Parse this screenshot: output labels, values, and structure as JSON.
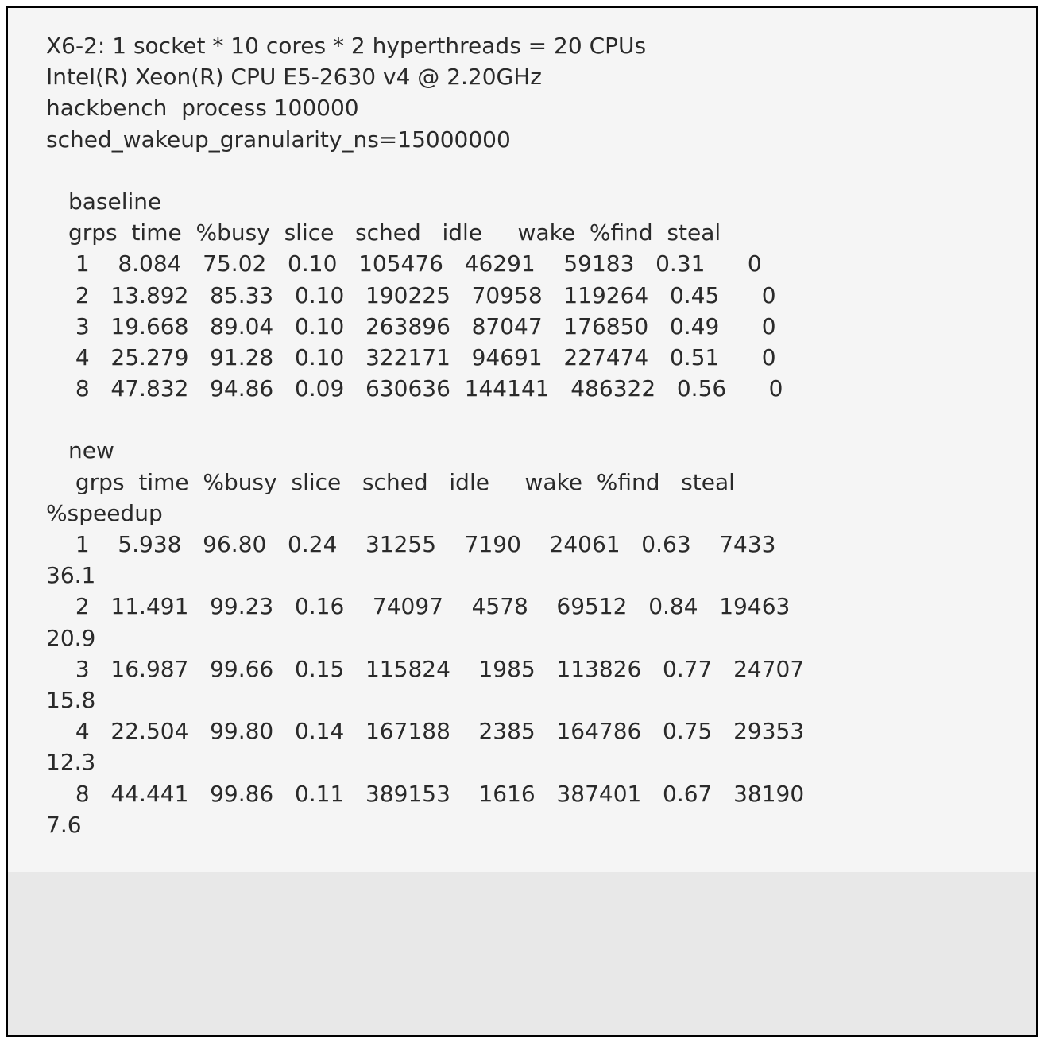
{
  "header": {
    "line1": "X6-2: 1 socket * 10 cores * 2 hyperthreads = 20 CPUs",
    "line2": "Intel(R) Xeon(R) CPU E5-2630 v4 @ 2.20GHz",
    "line3": "hackbench  process 100000",
    "line4": "sched_wakeup_granularity_ns=15000000"
  },
  "baseline": {
    "title": "baseline",
    "columns": "grps  time  %busy  slice   sched   idle     wake  %find  steal",
    "rows": [
      " 1    8.084   75.02   0.10   105476   46291    59183   0.31      0",
      " 2   13.892   85.33   0.10   190225   70958   119264   0.45      0",
      " 3   19.668   89.04   0.10   263896   87047   176850   0.49      0",
      " 4   25.279   91.28   0.10   322171   94691   227474   0.51      0",
      " 8   47.832   94.86   0.09   630636  144141   486322   0.56      0"
    ]
  },
  "new": {
    "title": "new",
    "columns_line1": " grps  time  %busy  slice   sched   idle     wake  %find   steal",
    "columns_line2": "%speedup",
    "rows": [
      " 1    5.938   96.80   0.24    31255    7190    24061   0.63    7433",
      "36.1",
      " 2   11.491   99.23   0.16    74097    4578    69512   0.84   19463",
      "20.9",
      " 3   16.987   99.66   0.15   115824    1985   113826   0.77   24707",
      "15.8",
      " 4   22.504   99.80   0.14   167188    2385   164786   0.75   29353",
      "12.3",
      " 8   44.441   99.86   0.11   389153    1616   387401   0.67   38190",
      "7.6"
    ]
  },
  "chart_data": {
    "type": "table",
    "title": "hackbench benchmark results — baseline vs new scheduler (steal)",
    "system": "X6-2: 1 socket * 10 cores * 2 hyperthreads = 20 CPUs; Intel(R) Xeon(R) CPU E5-2630 v4 @ 2.20GHz",
    "benchmark": "hackbench process 100000",
    "param": "sched_wakeup_granularity_ns=15000000",
    "columns": [
      "grps",
      "time",
      "%busy",
      "slice",
      "sched",
      "idle",
      "wake",
      "%find",
      "steal",
      "%speedup"
    ],
    "series": [
      {
        "name": "baseline",
        "rows": [
          {
            "grps": 1,
            "time": 8.084,
            "%busy": 75.02,
            "slice": 0.1,
            "sched": 105476,
            "idle": 46291,
            "wake": 59183,
            "%find": 0.31,
            "steal": 0
          },
          {
            "grps": 2,
            "time": 13.892,
            "%busy": 85.33,
            "slice": 0.1,
            "sched": 190225,
            "idle": 70958,
            "wake": 119264,
            "%find": 0.45,
            "steal": 0
          },
          {
            "grps": 3,
            "time": 19.668,
            "%busy": 89.04,
            "slice": 0.1,
            "sched": 263896,
            "idle": 87047,
            "wake": 176850,
            "%find": 0.49,
            "steal": 0
          },
          {
            "grps": 4,
            "time": 25.279,
            "%busy": 91.28,
            "slice": 0.1,
            "sched": 322171,
            "idle": 94691,
            "wake": 227474,
            "%find": 0.51,
            "steal": 0
          },
          {
            "grps": 8,
            "time": 47.832,
            "%busy": 94.86,
            "slice": 0.09,
            "sched": 630636,
            "idle": 144141,
            "wake": 486322,
            "%find": 0.56,
            "steal": 0
          }
        ]
      },
      {
        "name": "new",
        "rows": [
          {
            "grps": 1,
            "time": 5.938,
            "%busy": 96.8,
            "slice": 0.24,
            "sched": 31255,
            "idle": 7190,
            "wake": 24061,
            "%find": 0.63,
            "steal": 7433,
            "%speedup": 36.1
          },
          {
            "grps": 2,
            "time": 11.491,
            "%busy": 99.23,
            "slice": 0.16,
            "sched": 74097,
            "idle": 4578,
            "wake": 69512,
            "%find": 0.84,
            "steal": 19463,
            "%speedup": 20.9
          },
          {
            "grps": 3,
            "time": 16.987,
            "%busy": 99.66,
            "slice": 0.15,
            "sched": 115824,
            "idle": 1985,
            "wake": 113826,
            "%find": 0.77,
            "steal": 24707,
            "%speedup": 15.8
          },
          {
            "grps": 4,
            "time": 22.504,
            "%busy": 99.8,
            "slice": 0.14,
            "sched": 167188,
            "idle": 2385,
            "wake": 164786,
            "%find": 0.75,
            "steal": 29353,
            "%speedup": 12.3
          },
          {
            "grps": 8,
            "time": 44.441,
            "%busy": 99.86,
            "slice": 0.11,
            "sched": 389153,
            "idle": 1616,
            "wake": 387401,
            "%find": 0.67,
            "steal": 38190,
            "%speedup": 7.6
          }
        ]
      }
    ]
  }
}
